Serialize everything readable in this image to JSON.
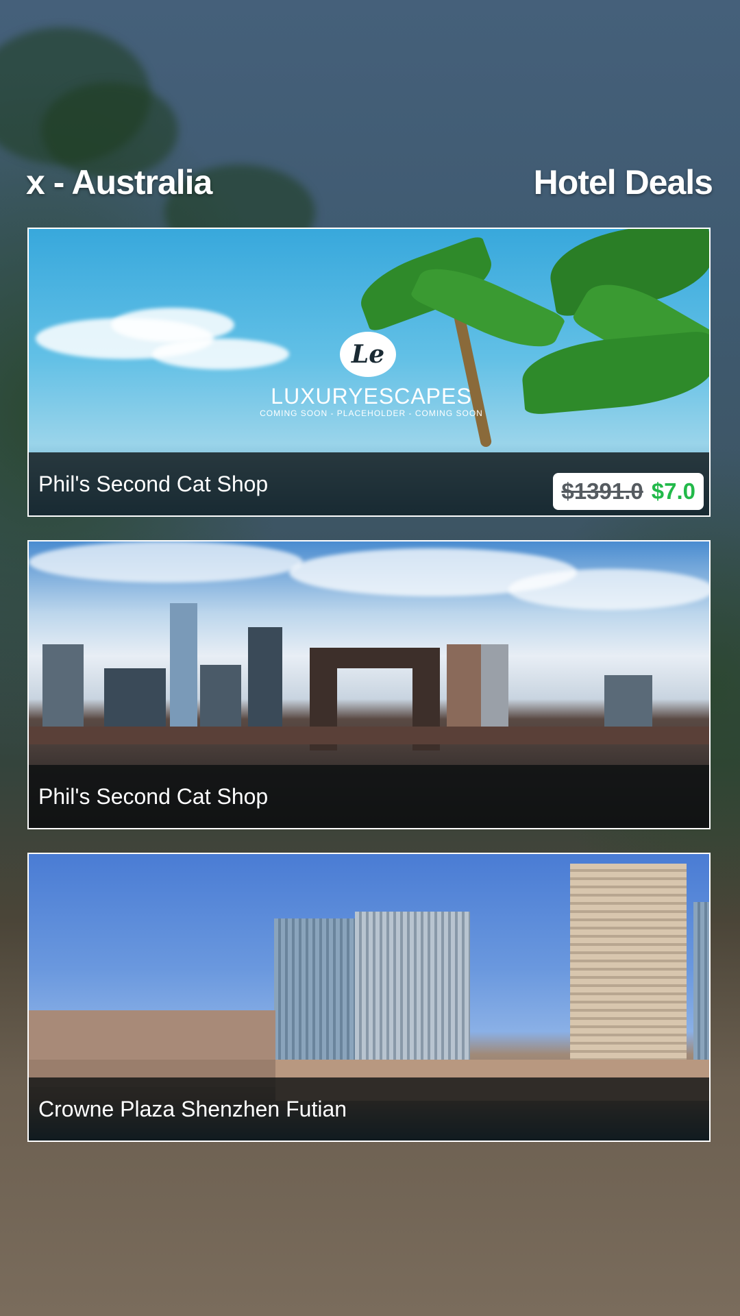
{
  "header": {
    "left_title": "x - Australia",
    "right_title": "Hotel Deals"
  },
  "deals": [
    {
      "name": "Phil's Second Cat Shop",
      "image": "luxury-escapes-placeholder",
      "logo_monogram": "Le",
      "logo_text": "LUXURYESCAPES",
      "logo_subtext": "COMING SOON  -  PLACEHOLDER - COMING SOON",
      "price_original": "$1391.0",
      "price_current": "$7.0"
    },
    {
      "name": "Phil's Second Cat Shop",
      "image": "brooklyn-bridge-skyline"
    },
    {
      "name": "Crowne Plaza Shenzhen Futian",
      "image": "hotel-towers-pool"
    }
  ],
  "colors": {
    "price_current": "#22b94a",
    "price_original": "#555b60",
    "card_border": "#ffffff"
  }
}
